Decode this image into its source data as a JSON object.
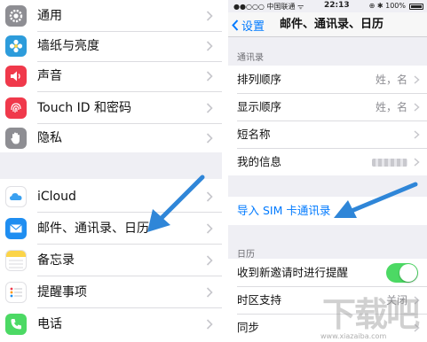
{
  "left": {
    "group1": [
      {
        "label": "通用",
        "icon": "gear-icon",
        "color": "#8e8e93"
      },
      {
        "label": "墙纸与亮度",
        "icon": "flower-icon",
        "color": "#2d9cdb"
      },
      {
        "label": "声音",
        "icon": "speaker-icon",
        "color": "#f0394b"
      },
      {
        "label": "Touch ID 和密码",
        "icon": "fingerprint-icon",
        "color": "#f0394b"
      },
      {
        "label": "隐私",
        "icon": "hand-icon",
        "color": "#8e8e93"
      }
    ],
    "group2": [
      {
        "label": "iCloud",
        "icon": "cloud-icon",
        "color": "#ffffff"
      },
      {
        "label": "邮件、通讯录、日历",
        "icon": "mail-icon",
        "color": "#1f8ef1"
      },
      {
        "label": "备忘录",
        "icon": "notes-icon",
        "color": "#fbd449"
      },
      {
        "label": "提醒事项",
        "icon": "list-icon",
        "color": "#ffffff"
      },
      {
        "label": "电话",
        "icon": "phone-icon",
        "color": "#4cd964"
      }
    ]
  },
  "right": {
    "status": {
      "carrier": "●●○○○ 中国联通 ᯤ",
      "time": "22:13",
      "battery": "⊕ ✱ 100%"
    },
    "nav": {
      "back_label": "设置",
      "title": "邮件、通讯录、日历"
    },
    "contacts_header": "通讯录",
    "contacts_rows": [
      {
        "label": "排列顺序",
        "value": "姓，名"
      },
      {
        "label": "显示顺序",
        "value": "姓，名"
      },
      {
        "label": "短名称",
        "value": ""
      },
      {
        "label": "我的信息",
        "value": ""
      }
    ],
    "import_sim_label": "导入 SIM 卡通讯录",
    "calendar_header": "日历",
    "calendar_rows": [
      {
        "label": "收到新邀请时进行提醒",
        "toggle_on": true
      },
      {
        "label": "时区支持",
        "value": "关闭"
      },
      {
        "label": "同步",
        "value": ""
      }
    ]
  },
  "watermark": {
    "text": "下载吧",
    "sub": "www.xiazaiba.com"
  },
  "colors": {
    "ios_blue": "#007aff",
    "toggle_green": "#4cd964",
    "arrow_blue": "#2f86d8"
  }
}
